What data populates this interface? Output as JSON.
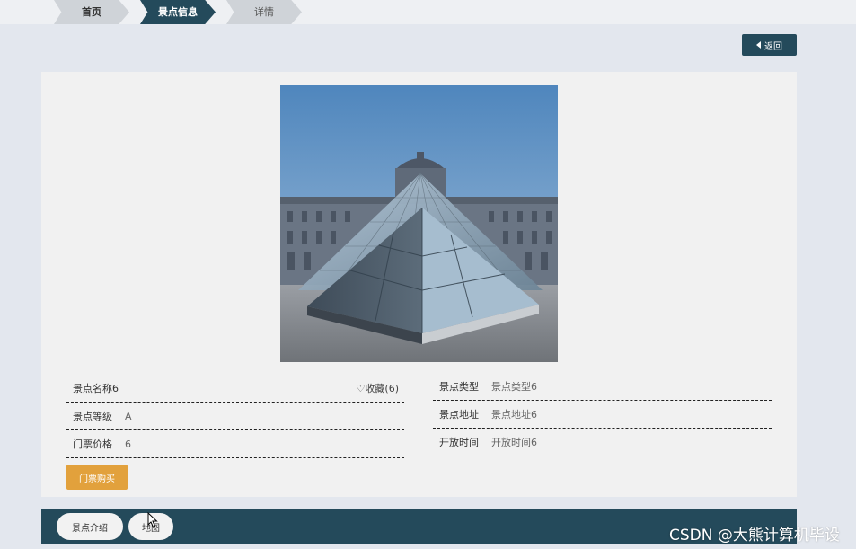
{
  "breadcrumb": {
    "home": "首页",
    "attraction_info": "景点信息",
    "details": "详情"
  },
  "back_button": {
    "label": "返回"
  },
  "attraction": {
    "name": "景点名称6",
    "favorite": "收藏(6)",
    "type_label": "景点类型",
    "type_value": "景点类型6",
    "level_label": "景点等级",
    "level_value": "A",
    "address_label": "景点地址",
    "address_value": "景点地址6",
    "price_label": "门票价格",
    "price_value": "6",
    "hours_label": "开放时间",
    "hours_value": "开放时间6"
  },
  "buy_button": {
    "label": "门票购买"
  },
  "bottom_tabs": {
    "intro": "景点介绍",
    "map": "地图"
  },
  "watermark": "CSDN @大熊计算机毕设",
  "colors": {
    "primary": "#244a5b",
    "buy": "#e2a13c",
    "background": "#e3e7ee",
    "panel": "#f1f1f1"
  }
}
